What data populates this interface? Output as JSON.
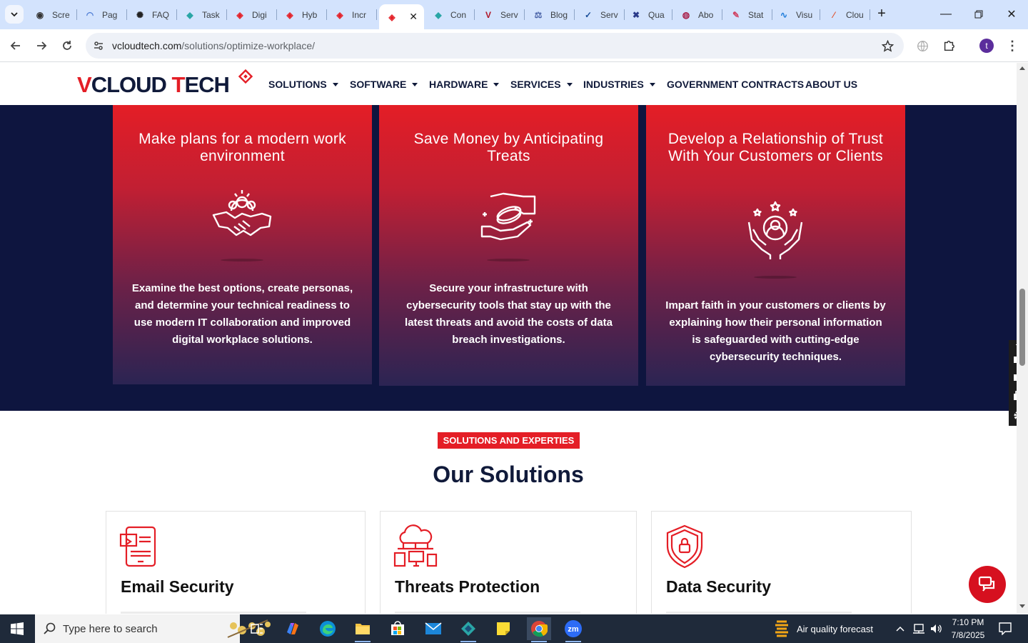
{
  "browser": {
    "tabs": [
      {
        "label": "Scre",
        "icon": "screencast-icon"
      },
      {
        "label": "Pag",
        "icon": "pagespeed-icon"
      },
      {
        "label": "FAQ",
        "icon": "chatgpt-icon"
      },
      {
        "label": "Task",
        "icon": "task-icon"
      },
      {
        "label": "Digi",
        "icon": "vcloud-icon"
      },
      {
        "label": "Hyb",
        "icon": "vcloud-icon"
      },
      {
        "label": "Incr",
        "icon": "vcloud-icon"
      },
      {
        "label": "",
        "icon": "vcloud-icon",
        "active": true
      },
      {
        "label": "Con",
        "icon": "task-icon"
      },
      {
        "label": "Serv",
        "icon": "v-icon"
      },
      {
        "label": "Blog",
        "icon": "scales-icon"
      },
      {
        "label": "Serv",
        "icon": "check-icon"
      },
      {
        "label": "Qua",
        "icon": "x-icon"
      },
      {
        "label": "Abo",
        "icon": "pill-icon"
      },
      {
        "label": "Stat",
        "icon": "pen-icon"
      },
      {
        "label": "Visu",
        "icon": "pulse-icon"
      },
      {
        "label": "Clou",
        "icon": "slash-icon"
      }
    ],
    "url_host": "vcloudtech.com",
    "url_path": "/solutions/optimize-workplace/",
    "profile_initial": "t"
  },
  "site": {
    "logo_text": "VCLOUD TECH",
    "nav": [
      {
        "label": "SOLUTIONS",
        "caret": true
      },
      {
        "label": "SOFTWARE",
        "caret": true
      },
      {
        "label": "HARDWARE",
        "caret": true
      },
      {
        "label": "SERVICES",
        "caret": true
      },
      {
        "label": "INDUSTRIES",
        "caret": true
      },
      {
        "label": "GOVERNMENT CONTRACTS",
        "caret": false
      },
      {
        "label": "ABOUT US",
        "caret": false
      }
    ],
    "cards": [
      {
        "title": "Make plans for a modern work environment",
        "icon": "team-handshake-icon",
        "body": "Examine the best options, create personas, and determine your technical readiness to use modern IT collaboration and improved digital workplace solutions."
      },
      {
        "title": "Save Money by Anticipating Treats",
        "icon": "coin-handshake-icon",
        "body": "Secure your infrastructure with cybersecurity tools that stay up with the latest threats and avoid the costs of data breach investigations."
      },
      {
        "title": "Develop a Relationship of Trust With Your Customers or Clients",
        "icon": "trusted-customer-icon",
        "body": "Impart faith in your customers or clients by explaining how their personal information is safeguarded with cutting-edge cybersecurity techniques."
      }
    ],
    "solutions_badge": "SOLUTIONS AND EXPERTIES",
    "solutions_title": "Our Solutions",
    "solutions": [
      {
        "name": "Email Security",
        "icon": "email-device-icon"
      },
      {
        "name": "Threats Protection",
        "icon": "cloud-network-icon"
      },
      {
        "name": "Data Security",
        "icon": "shield-lock-icon"
      }
    ]
  },
  "taskbar": {
    "search_placeholder": "Type here to search",
    "weather": "Air quality forecast",
    "time": "7:10 PM",
    "date": "7/8/2025"
  },
  "colors": {
    "brand_red": "#e41e26",
    "navy": "#0e153f"
  }
}
